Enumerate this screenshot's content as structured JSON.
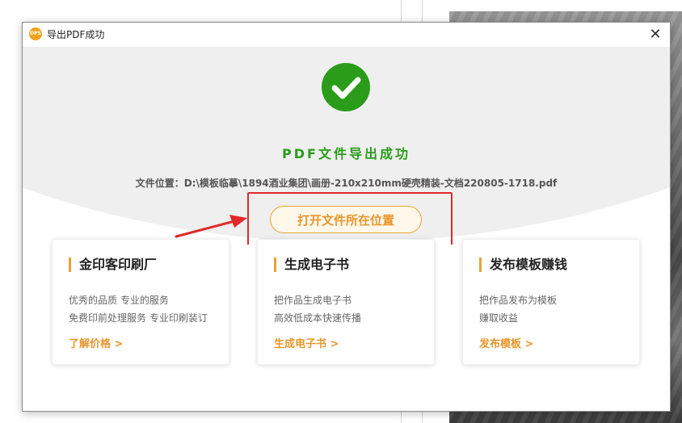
{
  "dialog": {
    "title": "导出PDF成功",
    "logo_text": "DPS",
    "close_glyph": "✕"
  },
  "hero": {
    "success_title": "PDF文件导出成功",
    "filepath_label": "文件位置：",
    "filepath_value": "D:\\模板临摹\\1894酒业集团\\画册-210x210mm硬壳精装-文档220805-1718.pdf",
    "open_button": "打开文件所在位置"
  },
  "cards": [
    {
      "title": "金印客印刷厂",
      "desc1": "优秀的品质 专业的服务",
      "desc2": "免费印前处理服务 专业印刷装订",
      "link": "了解价格 >"
    },
    {
      "title": "生成电子书",
      "desc1": "把作品生成电子书",
      "desc2": "高效低成本快速传播",
      "link": "生成电子书 >"
    },
    {
      "title": "发布模板赚钱",
      "desc1": "把作品发布为模板",
      "desc2": "赚取收益",
      "link": "发布模板 >"
    }
  ],
  "icons": {
    "success": "check-icon",
    "close": "close-icon",
    "annotation": "arrow-icon"
  },
  "colors": {
    "success_green": "#2a9c1a",
    "accent_orange": "#e8962a",
    "highlight_red": "#e0292b"
  }
}
